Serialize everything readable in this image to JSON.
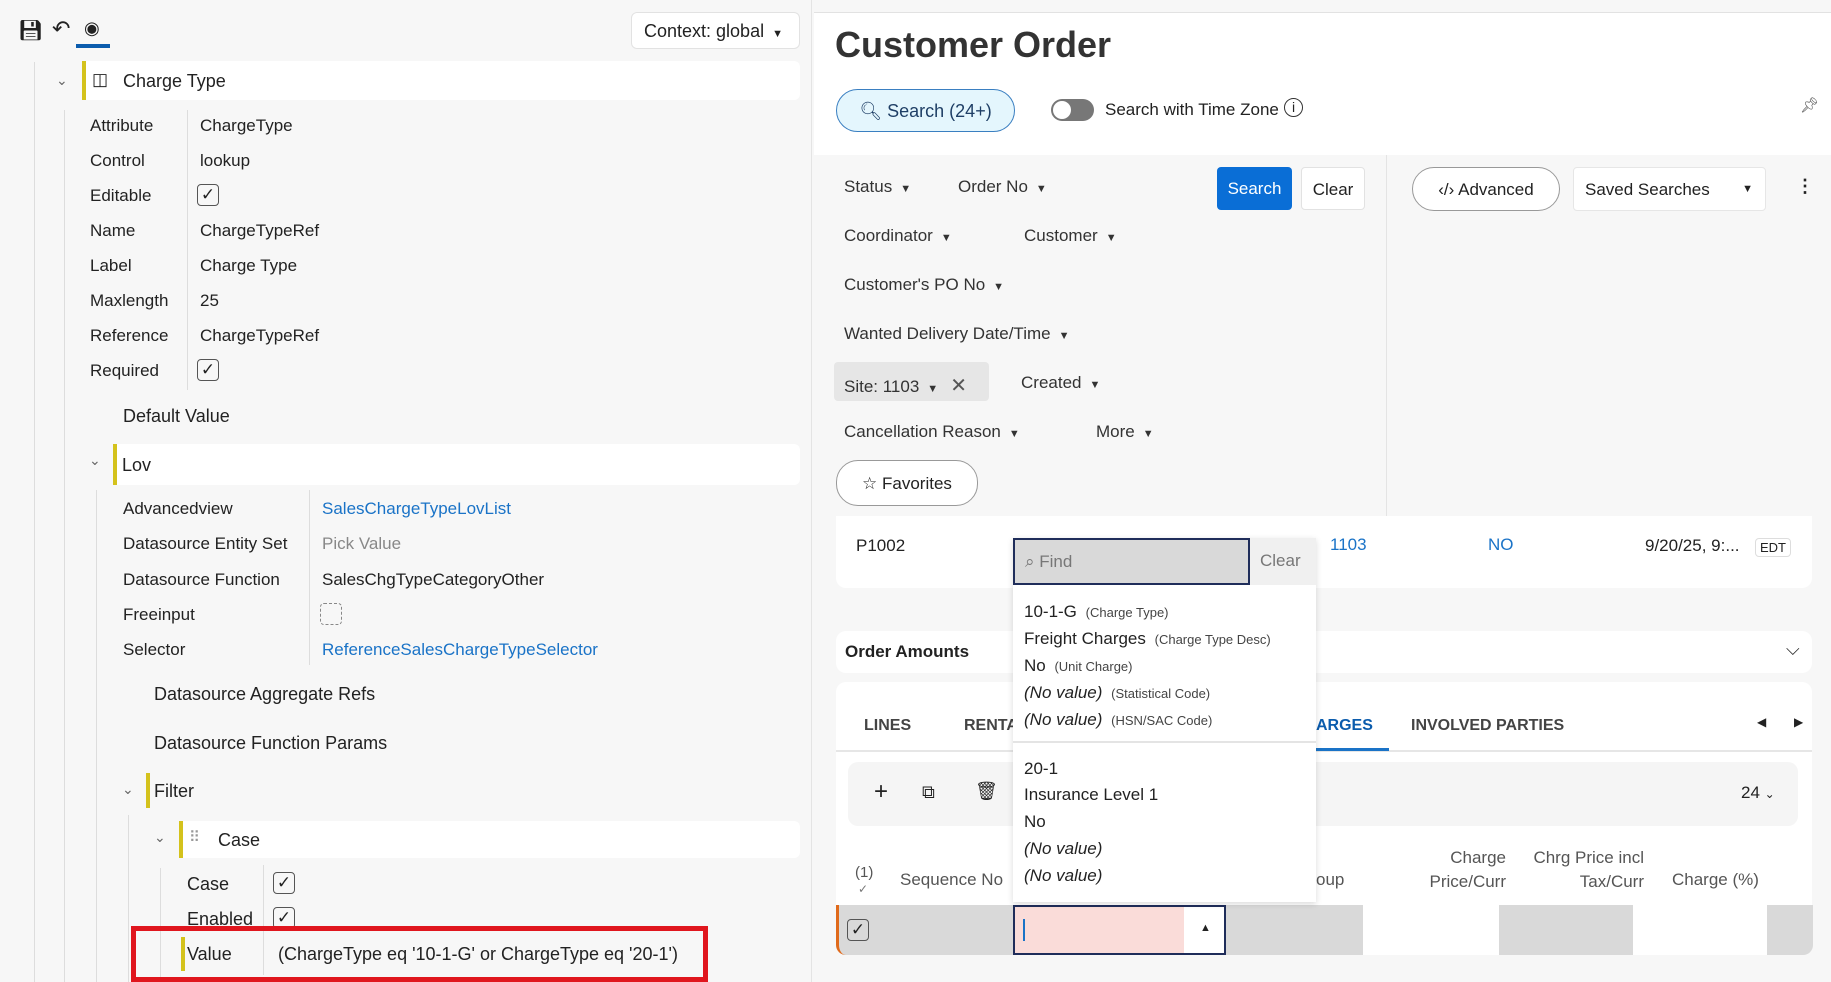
{
  "toolbar": {
    "icons": [
      "save-icon",
      "undo-icon",
      "preview-icon"
    ],
    "context": "Context: global"
  },
  "tree": {
    "charge_type": {
      "title": "Charge Type",
      "props": [
        {
          "label": "Attribute",
          "value": "ChargeType"
        },
        {
          "label": "Control",
          "value": "lookup"
        },
        {
          "label": "Editable",
          "checked": true
        },
        {
          "label": "Name",
          "value": "ChargeTypeRef"
        },
        {
          "label": "Label",
          "value": "Charge Type"
        },
        {
          "label": "Maxlength",
          "value": "25"
        },
        {
          "label": "Reference",
          "value": "ChargeTypeRef"
        },
        {
          "label": "Required",
          "checked": true
        }
      ]
    },
    "default_value": "Default Value",
    "lov": {
      "title": "Lov",
      "props": [
        {
          "label": "Advancedview",
          "value": "SalesChargeTypeLovList"
        },
        {
          "label": "Datasource Entity Set",
          "value": "Pick Value"
        },
        {
          "label": "Datasource Function",
          "value": "SalesChgTypeCategoryOther"
        },
        {
          "label": "Freeinput",
          "checked": false
        },
        {
          "label": "Selector",
          "value": "ReferenceSalesChargeTypeSelector"
        }
      ]
    },
    "aggregate_refs": "Datasource Aggregate Refs",
    "function_params": "Datasource Function Params",
    "filter": "Filter",
    "case": {
      "title": "Case",
      "props": [
        {
          "label": "Case",
          "checked": true
        },
        {
          "label": "Enabled",
          "checked": true
        }
      ],
      "value_label": "Value",
      "value": "(ChargeType eq '10-1-G' or ChargeType eq '20-1')"
    }
  },
  "page": {
    "title": "Customer Order",
    "search_pill": "Search (24+)",
    "timezone_label": "Search with Time Zone",
    "timezone_on": false
  },
  "filters": {
    "chips": [
      "Status",
      "Order No",
      "Coordinator",
      "Customer",
      "Customer's PO No",
      "Wanted Delivery Date/Time",
      "Site: 1103",
      "Created",
      "Cancellation Reason",
      "More"
    ],
    "search": "Search",
    "clear": "Clear",
    "favorites": "Favorites",
    "advanced": "Advanced",
    "saved_searches": "Saved Searches"
  },
  "record": {
    "order_no": "P1002",
    "site": "1103",
    "flag": "NO",
    "date": "9/20/25, 9:...",
    "tz": "EDT"
  },
  "order_amounts": "Order Amounts",
  "tabs": [
    "LINES",
    "RENTA",
    "ARGES",
    "INVOLVED PARTIES"
  ],
  "grid": {
    "page_size": "24",
    "selected": "(1)",
    "headers": [
      "Sequence No",
      "oup",
      "Charge Price/Curr",
      "Chrg Price incl Tax/Curr",
      "Charge (%)"
    ]
  },
  "lookup": {
    "placeholder": "Find",
    "clear": "Clear",
    "items": [
      [
        {
          "v": "10-1-G",
          "k": "(Charge Type)"
        },
        {
          "v": "Freight Charges",
          "k": "(Charge Type Desc)"
        },
        {
          "v": "No",
          "k": "(Unit Charge)"
        },
        {
          "v": "(No value)",
          "k": "(Statistical Code)",
          "i": true
        },
        {
          "v": "(No value)",
          "k": "(HSN/SAC Code)",
          "i": true
        }
      ],
      [
        {
          "v": "20-1"
        },
        {
          "v": "Insurance Level 1"
        },
        {
          "v": "No"
        },
        {
          "v": "(No value)",
          "i": true
        },
        {
          "v": "(No value)",
          "i": true
        }
      ]
    ]
  }
}
